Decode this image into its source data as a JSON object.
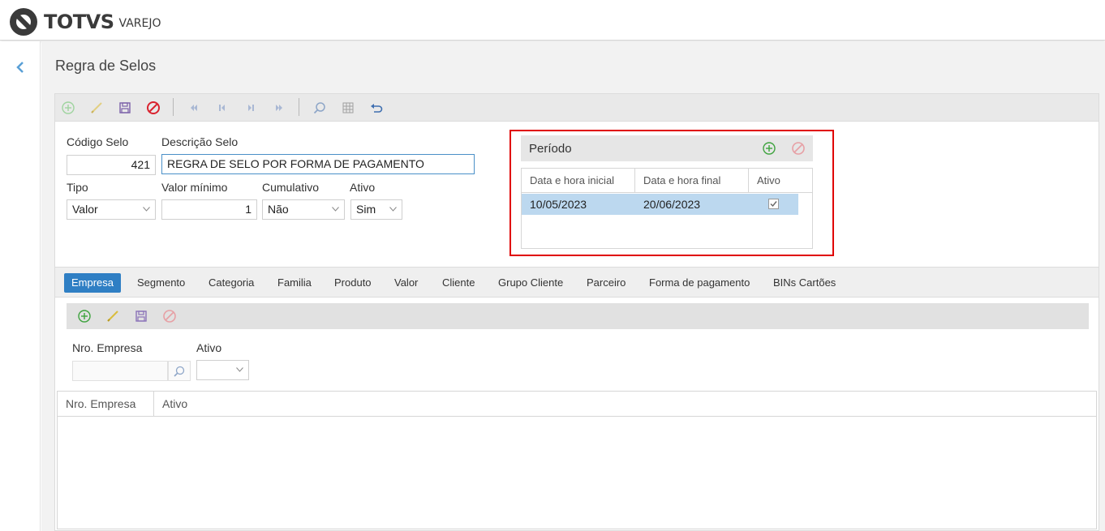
{
  "app": {
    "brand": "TOTVS",
    "brand_sub": "VAREJO"
  },
  "page": {
    "title": "Regra de Selos"
  },
  "toolbar": {
    "buttons": [
      "add-icon",
      "edit-icon",
      "save-icon",
      "cancel-icon",
      "first-icon",
      "previous-icon",
      "next-icon",
      "last-icon",
      "search-icon",
      "grid-icon",
      "undo-icon"
    ]
  },
  "form": {
    "codigo_label": "Código Selo",
    "codigo_value": "421",
    "descricao_label": "Descrição Selo",
    "descricao_value": "REGRA DE SELO POR FORMA DE PAGAMENTO",
    "tipo_label": "Tipo",
    "tipo_value": "Valor",
    "valor_minimo_label": "Valor mínimo",
    "valor_minimo_value": "1",
    "cumulativo_label": "Cumulativo",
    "cumulativo_value": "Não",
    "ativo_label": "Ativo",
    "ativo_value": "Sim"
  },
  "periodo": {
    "title": "Período",
    "columns": [
      "Data e hora inicial",
      "Data e hora final",
      "Ativo"
    ],
    "rows": [
      {
        "inicio": "10/05/2023",
        "fim": "20/06/2023",
        "ativo": true
      }
    ]
  },
  "tabs": [
    "Empresa",
    "Segmento",
    "Categoria",
    "Familia",
    "Produto",
    "Valor",
    "Cliente",
    "Grupo Cliente",
    "Parceiro",
    "Forma de pagamento",
    "BINs Cartões"
  ],
  "selected_tab": "Empresa",
  "empresa": {
    "nro_label": "Nro. Empresa",
    "nro_value": "",
    "ativo_label": "Ativo",
    "ativo_value": "",
    "grid_columns": [
      "Nro. Empresa",
      "Ativo"
    ]
  },
  "colors": {
    "accent": "#2f7fc4",
    "highlight_border": "#e00000",
    "selected_row": "#bcd8ef"
  }
}
